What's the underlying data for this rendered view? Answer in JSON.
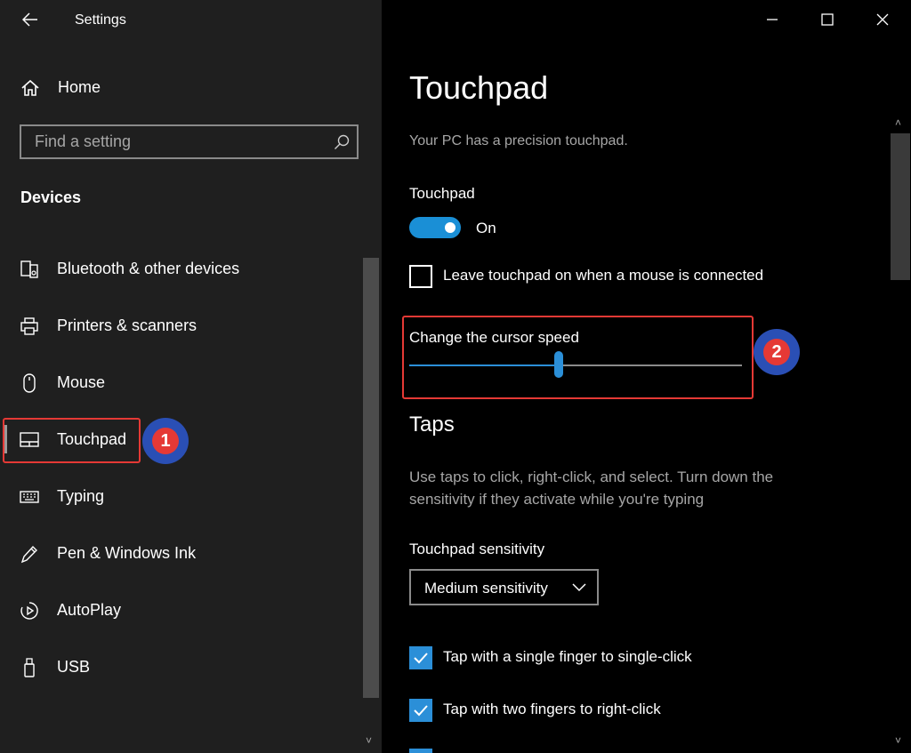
{
  "app": {
    "title": "Settings"
  },
  "sidebar": {
    "home_label": "Home",
    "search": {
      "placeholder": "Find a setting"
    },
    "section_heading": "Devices",
    "items": [
      {
        "label": "Bluetooth & other devices",
        "icon": "bluetooth-devices-icon"
      },
      {
        "label": "Printers & scanners",
        "icon": "printer-icon"
      },
      {
        "label": "Mouse",
        "icon": "mouse-icon"
      },
      {
        "label": "Touchpad",
        "icon": "touchpad-icon",
        "selected": true
      },
      {
        "label": "Typing",
        "icon": "keyboard-icon"
      },
      {
        "label": "Pen & Windows Ink",
        "icon": "pen-icon"
      },
      {
        "label": "AutoPlay",
        "icon": "autoplay-icon"
      },
      {
        "label": "USB",
        "icon": "usb-icon"
      }
    ]
  },
  "annotations": [
    {
      "number": "1"
    },
    {
      "number": "2"
    }
  ],
  "main": {
    "page_title": "Touchpad",
    "description": "Your PC has a precision touchpad.",
    "touchpad_toggle": {
      "label": "Touchpad",
      "state_label": "On",
      "on": true
    },
    "leave_on_checkbox": {
      "label": "Leave touchpad on when a mouse is connected",
      "checked": false
    },
    "cursor_speed": {
      "label": "Change the cursor speed",
      "value_fraction": 0.45
    },
    "taps": {
      "title": "Taps",
      "description": "Use taps to click, right-click, and select. Turn down the sensitivity if they activate while you're typing",
      "sensitivity_label": "Touchpad sensitivity",
      "sensitivity_value": "Medium sensitivity",
      "checkboxes": [
        {
          "label": "Tap with a single finger to single-click",
          "checked": true
        },
        {
          "label": "Tap with two fingers to right-click",
          "checked": true
        }
      ]
    }
  },
  "colors": {
    "accent": "#2b8fd8",
    "annotation_red": "#e53935",
    "annotation_blue": "#2a4fb5"
  }
}
